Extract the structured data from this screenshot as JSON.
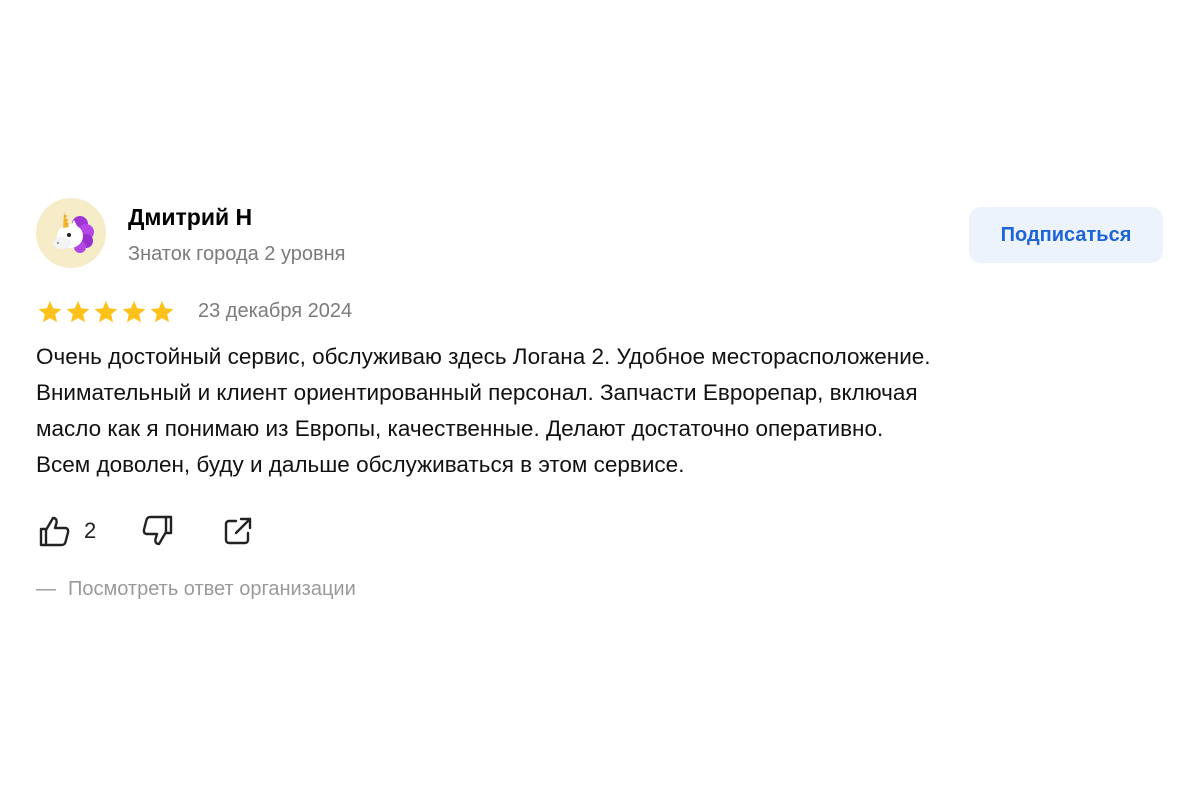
{
  "author": {
    "name": "Дмитрий Н",
    "level": "Знаток города 2 уровня",
    "avatar_icon": "unicorn-icon"
  },
  "subscribe_label": "Подписаться",
  "rating": {
    "value": 5,
    "max": 5,
    "star_color": "#fcc21b"
  },
  "review": {
    "date": "23 декабря 2024",
    "lines": [
      "Очень достойный сервис, обслуживаю здесь Логана 2. Удобное месторасположение.",
      "Внимательный и клиент ориентированный персонал. Запчасти Еврорепар, включая",
      "масло как я понимаю из Европы, качественные. Делают достаточно оперативно.",
      "Всем доволен, буду и дальше обслуживаться в этом сервисе."
    ]
  },
  "actions": {
    "like_icon": "thumbs-up-icon",
    "like_count": "2",
    "dislike_icon": "thumbs-down-icon",
    "share_icon": "share-icon"
  },
  "org_reply": {
    "dash": "—",
    "label": "Посмотреть ответ организации"
  },
  "colors": {
    "accent": "#1e64d8",
    "button_bg": "#edf3fc",
    "secondary_text": "#7b7b7b"
  }
}
